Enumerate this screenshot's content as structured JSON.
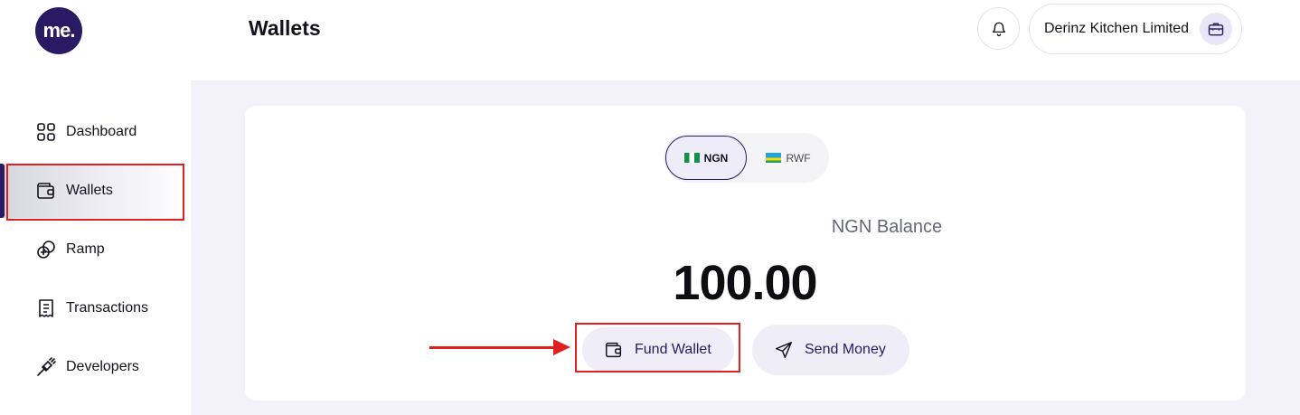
{
  "app": {
    "logo_text": "me."
  },
  "header": {
    "title": "Wallets",
    "company_name": "Derinz Kitchen Limited"
  },
  "sidebar": {
    "items": [
      {
        "label": "Dashboard",
        "icon": "grid-icon"
      },
      {
        "label": "Wallets",
        "icon": "wallet-icon",
        "active": true
      },
      {
        "label": "Ramp",
        "icon": "coins-icon"
      },
      {
        "label": "Transactions",
        "icon": "receipt-icon"
      },
      {
        "label": "Developers",
        "icon": "plug-icon"
      }
    ]
  },
  "wallet": {
    "currencies": [
      {
        "code": "NGN",
        "selected": true,
        "flag": "nigeria-flag-icon"
      },
      {
        "code": "RWF",
        "selected": false,
        "flag": "rwanda-flag-icon"
      }
    ],
    "balance_label": "NGN Balance",
    "balance_value": "100.00",
    "actions": {
      "fund_label": "Fund Wallet",
      "send_label": "Send Money"
    }
  },
  "colors": {
    "brand": "#2a1a63",
    "annotation": "#e02020",
    "content_bg": "#f3f2fa"
  }
}
